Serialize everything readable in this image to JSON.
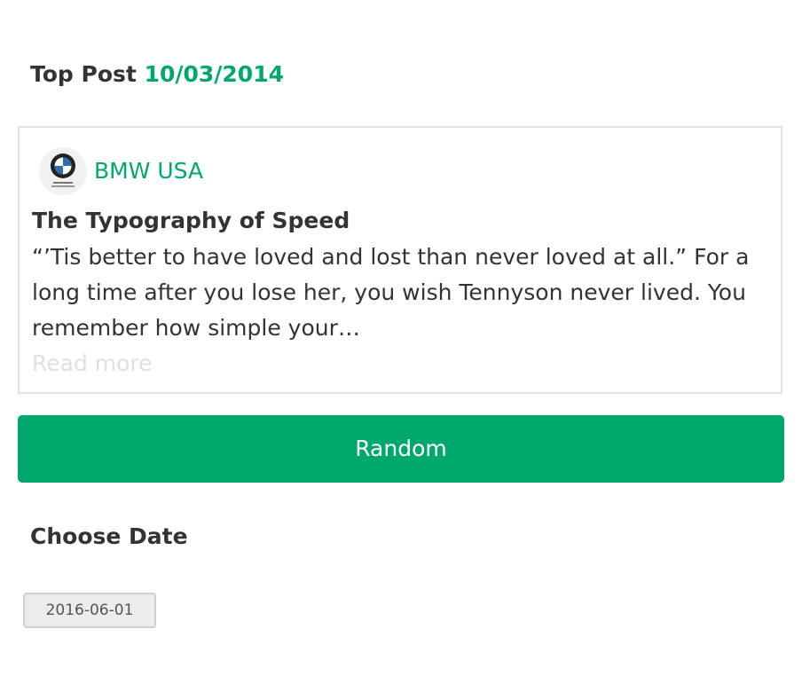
{
  "top_post": {
    "label": "Top Post",
    "date": "10/03/2014"
  },
  "post": {
    "author": "BMW USA",
    "avatar_icon": "bmw-logo-icon",
    "title": "The Typography of Speed",
    "excerpt": "“’Tis better to have loved and lost than never loved at all.” For a long time after you lose her, you wish Tennyson never lived. You remember how simple your…",
    "read_more": "Read more"
  },
  "random_button": {
    "label": "Random"
  },
  "choose_date": {
    "label": "Choose Date",
    "value": "2016-06-01"
  },
  "colors": {
    "accent": "#00a86b",
    "text": "#333333",
    "muted": "#e0e0e0",
    "border": "#e3e3e3"
  }
}
